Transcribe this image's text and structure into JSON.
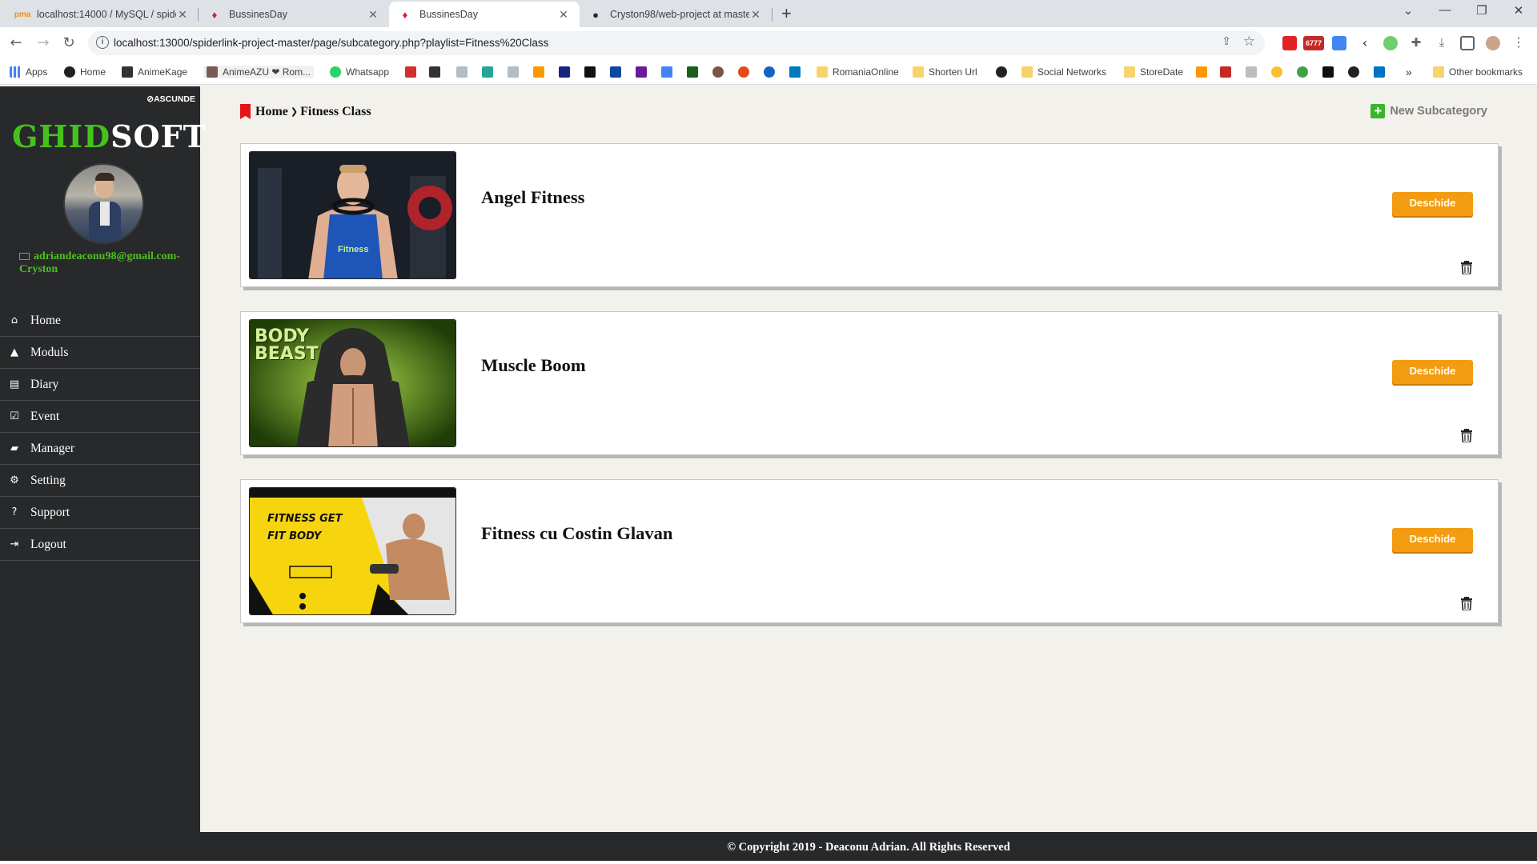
{
  "browser": {
    "tabs": [
      {
        "title": "localhost:14000 / MySQL / spider",
        "active": false
      },
      {
        "title": "BussinesDay",
        "active": false
      },
      {
        "title": "BussinesDay",
        "active": true
      },
      {
        "title": "Cryston98/web-project at master",
        "active": false
      }
    ],
    "url": "localhost:13000/spiderlink-project-master/page/subcategory.php?playlist=Fitness%20Class",
    "bookmarks": [
      {
        "label": "Apps"
      },
      {
        "label": "Home"
      },
      {
        "label": "AnimeKage"
      },
      {
        "label": "AnimeAZU ❤ Rom..."
      },
      {
        "label": "Whatsapp"
      },
      {
        "label": "RomaniaOnline"
      },
      {
        "label": "Shorten Url"
      },
      {
        "label": "Social Networks"
      },
      {
        "label": "StoreDate"
      },
      {
        "label": "Other bookmarks"
      }
    ],
    "badge_count": "6777"
  },
  "sidebar": {
    "hide_label": "⊘ASCUNDE",
    "logo_part1": "GHID",
    "logo_part2": "SOFT",
    "email": "adriandeaconu98@gmail.com-Cryston",
    "items": [
      {
        "label": "Home",
        "icon": "home-icon"
      },
      {
        "label": "Moduls",
        "icon": "graduation-cap-icon"
      },
      {
        "label": "Diary",
        "icon": "book-icon"
      },
      {
        "label": "Event",
        "icon": "calendar-check-icon"
      },
      {
        "label": "Manager",
        "icon": "folder-open-icon"
      },
      {
        "label": "Setting",
        "icon": "gears-icon"
      },
      {
        "label": "Support",
        "icon": "question-circle-icon"
      },
      {
        "label": "Logout",
        "icon": "sign-out-icon"
      }
    ]
  },
  "main": {
    "breadcrumb": {
      "home": "Home",
      "current": "Fitness Class"
    },
    "new_subcategory": "New Subcategory",
    "cards": [
      {
        "title": "Angel Fitness",
        "button": "Deschide"
      },
      {
        "title": "Muscle Boom",
        "button": "Deschide",
        "image_text": "BODY BEAST"
      },
      {
        "title": "Fitness cu Costin Glavan",
        "button": "Deschide",
        "image_text": "FITNESS GET FIT BODY"
      }
    ]
  },
  "footer": {
    "text": "© Copyright 2019 - Deaconu Adrian. All Rights Reserved"
  },
  "colors": {
    "accent_green": "#46c21c",
    "button_orange": "#f39c12",
    "sidebar_bg": "#27292b"
  }
}
